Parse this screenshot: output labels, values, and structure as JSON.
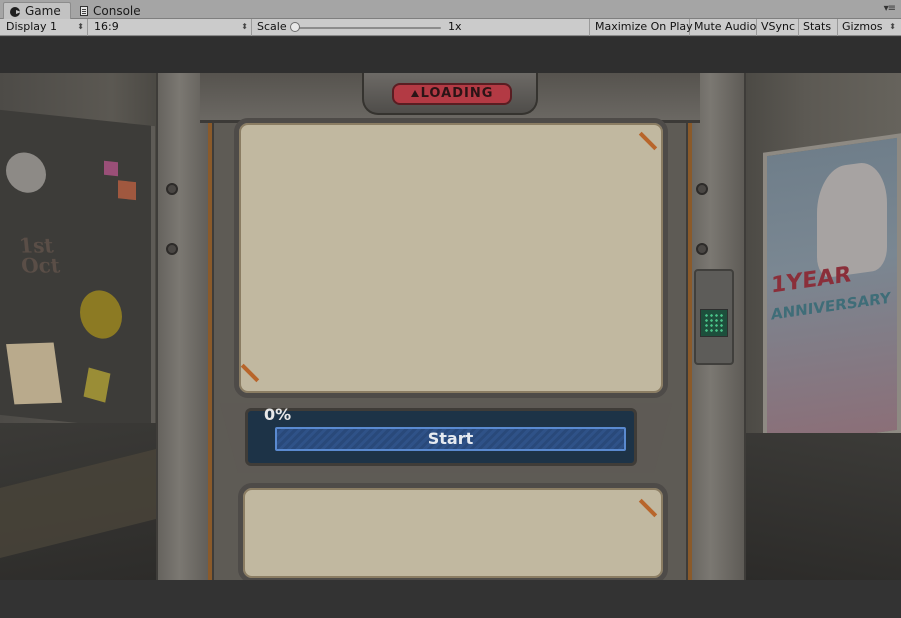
{
  "tabs": {
    "game_label": "Game",
    "console_label": "Console"
  },
  "toolbar": {
    "display": "Display 1",
    "aspect": "16:9",
    "scale_label": "Scale",
    "scale_value": "1x",
    "scale_level": 0.0,
    "maximize_on_play": "Maximize On Play",
    "mute_audio": "Mute Audio",
    "vsync": "VSync",
    "stats": "Stats",
    "gizmos": "Gizmos"
  },
  "game": {
    "loading_label": "LOADING",
    "progress_text": "0%",
    "start_label": "Start",
    "poster_line1": "1YEAR",
    "poster_line2": "ANNIVERSARY",
    "board_text": "1st Oct"
  },
  "colors": {
    "start_button": "#2f5288",
    "loading_badge": "#b33a44",
    "panel": "#c1b8a0"
  }
}
